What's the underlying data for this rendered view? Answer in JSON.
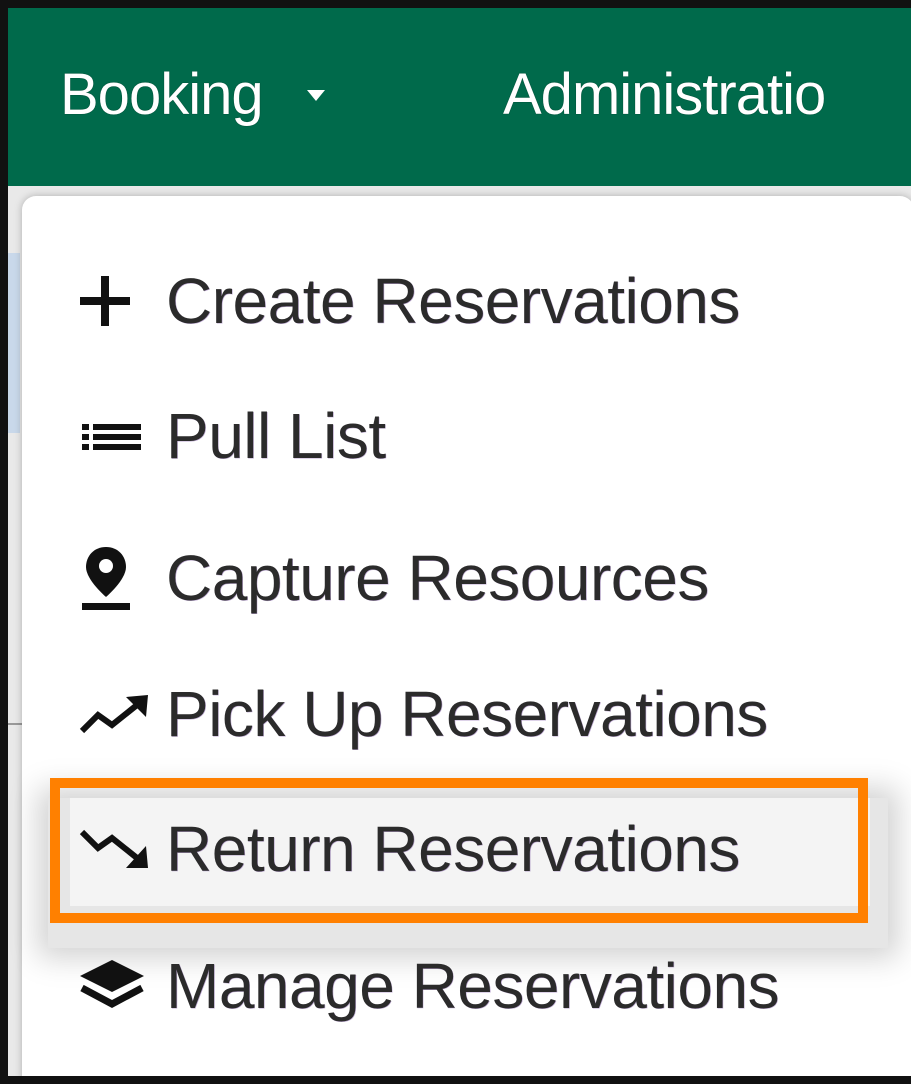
{
  "navbar": {
    "booking_label": "Booking",
    "administration_label": "Administratio",
    "background_color": "#006a4b"
  },
  "menu": {
    "items": [
      {
        "label": "Create Reservations",
        "icon": "plus-icon"
      },
      {
        "label": "Pull List",
        "icon": "list-icon"
      },
      {
        "label": "Capture Resources",
        "icon": "map-marker-icon"
      },
      {
        "label": "Pick Up Reservations",
        "icon": "trend-up-icon"
      },
      {
        "label": "Return Reservations",
        "icon": "trend-down-icon",
        "highlighted": true
      },
      {
        "label": "Manage Reservations",
        "icon": "layers-icon"
      }
    ]
  },
  "highlight_color": "#ff8000"
}
